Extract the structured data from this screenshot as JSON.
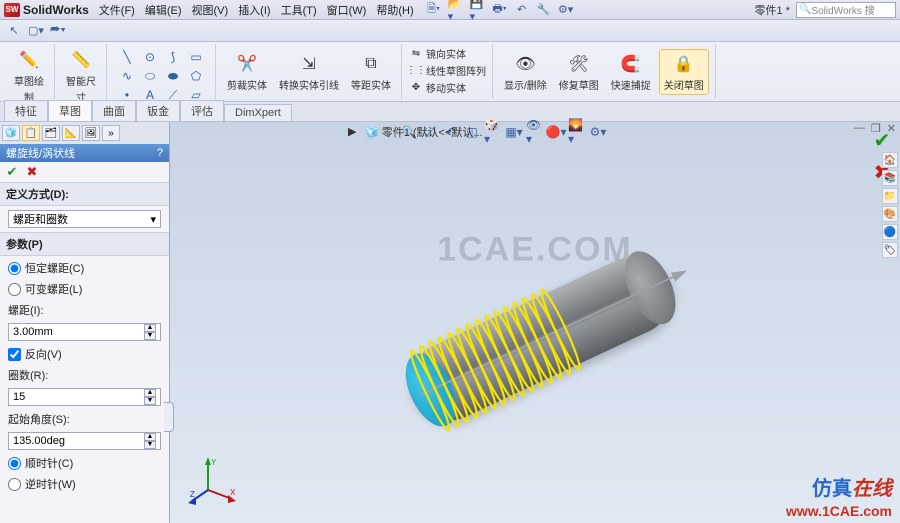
{
  "app": {
    "logo_text": "SW",
    "title": "SolidWorks"
  },
  "menu": {
    "file": "文件(F)",
    "edit": "编辑(E)",
    "view": "视图(V)",
    "insert": "插入(I)",
    "tools": "工具(T)",
    "window": "窗口(W)",
    "help": "帮助(H)"
  },
  "title_right": {
    "doc": "零件1 *",
    "search_placeholder": "SolidWorks 搜"
  },
  "ribbon": {
    "sketch_exit": {
      "l1": "草图绘",
      "l2": "制"
    },
    "smart_dim": {
      "l1": "智能尺",
      "l2": "寸"
    },
    "trim": "剪裁实体",
    "convert": "转换实体引线",
    "offset": "等距实体",
    "mirror": "镜向实体",
    "pattern": "线性草图阵列",
    "move": "移动实体",
    "display": "显示/删除",
    "repair": "修复草图",
    "snap": "快速捕捉",
    "close": "关闭草图"
  },
  "ftabs": {
    "feature": "特征",
    "sketch": "草图",
    "surface": "曲面",
    "sheet": "钣金",
    "evaluate": "评估",
    "dimxpert": "DimXpert"
  },
  "breadcrumb": {
    "part": "零件1 (默认<<默认..."
  },
  "pm": {
    "title": "螺旋线/涡状线",
    "help": "?",
    "def_sec": "定义方式(D):",
    "def_val": "螺距和圈数",
    "param_sec": "参数(P)",
    "const_pitch": "恒定螺距(C)",
    "var_pitch": "可变螺距(L)",
    "pitch_label": "螺距(I):",
    "pitch_val": "3.00mm",
    "reverse": "反向(V)",
    "rev_label": "圈数(R):",
    "rev_val": "15",
    "angle_label": "起始角度(S):",
    "angle_val": "135.00deg",
    "cw": "顺时针(C)",
    "ccw": "逆时针(W)"
  },
  "watermark": "1CAE.COM",
  "wm2_a": "仿真",
  "wm2_b": "在线",
  "wm3": "www.1CAE.com"
}
